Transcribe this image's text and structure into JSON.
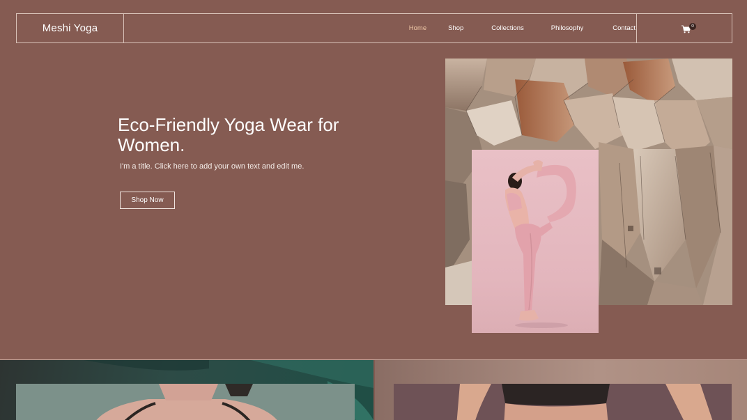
{
  "brand": {
    "name": "Meshi Yoga"
  },
  "nav": {
    "items": [
      {
        "label": "Home",
        "active": true
      },
      {
        "label": "Shop",
        "active": false
      },
      {
        "label": "Collections",
        "active": false
      },
      {
        "label": "Philosophy",
        "active": false
      },
      {
        "label": "Contact",
        "active": false
      }
    ],
    "cart_count": "0",
    "cart_icon": "cart-icon"
  },
  "hero": {
    "title": "Eco-Friendly Yoga Wear for Women.",
    "subtitle": "I'm a title. Click here to add your own text and edit me.",
    "cta_label": "Shop Now"
  },
  "colors": {
    "background": "#855b52",
    "nav_active": "#f0c9a8",
    "text": "#ffffff"
  }
}
